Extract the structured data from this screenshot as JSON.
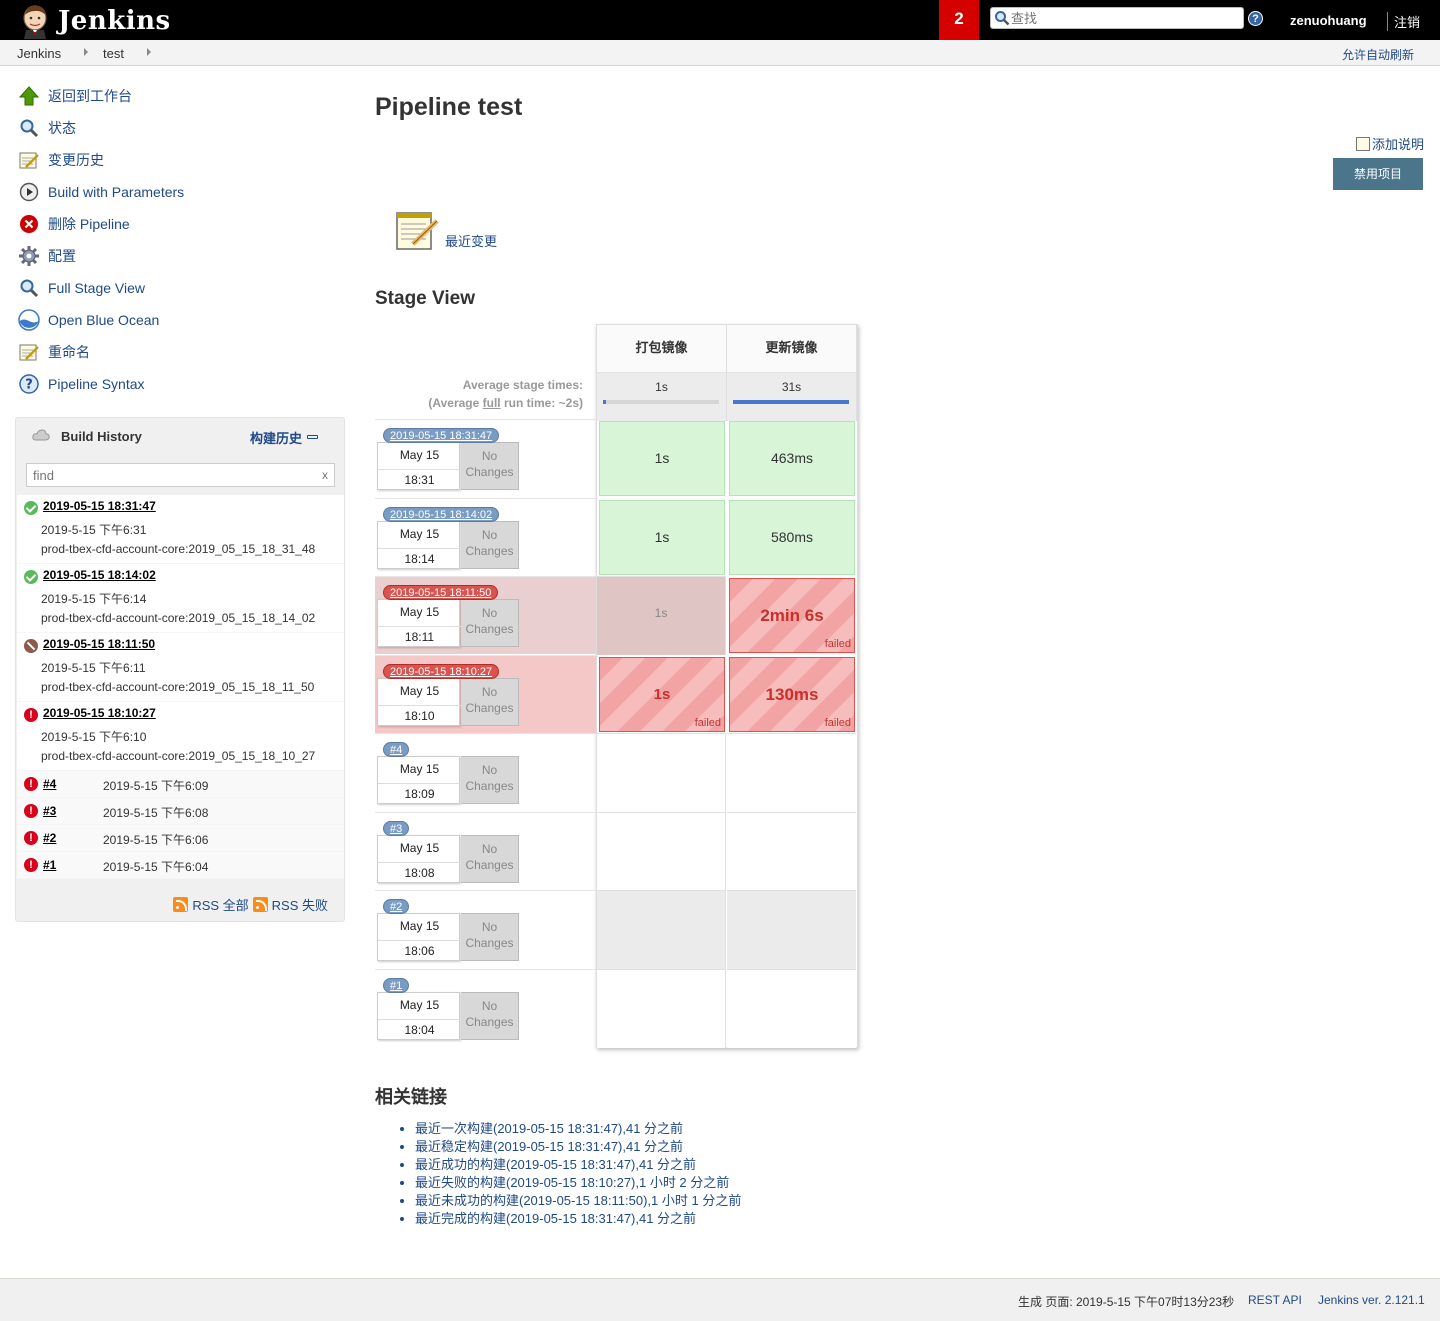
{
  "header": {
    "title": "Jenkins",
    "notification_count": "2",
    "search_placeholder": "查找",
    "user": "zenuohuang",
    "logout": "注销"
  },
  "breadcrumb": {
    "items": [
      "Jenkins",
      "test"
    ],
    "auto_refresh": "允许自动刷新"
  },
  "tasks": [
    {
      "label": "返回到工作台",
      "icon": "up-arrow-icon"
    },
    {
      "label": "状态",
      "icon": "search-icon"
    },
    {
      "label": "变更历史",
      "icon": "notepad-icon"
    },
    {
      "label": "Build with Parameters",
      "icon": "play-icon"
    },
    {
      "label": "删除 Pipeline",
      "icon": "delete-icon"
    },
    {
      "label": "配置",
      "icon": "gear-icon"
    },
    {
      "label": "Full Stage View",
      "icon": "search-icon"
    },
    {
      "label": "Open Blue Ocean",
      "icon": "blue-ocean-icon"
    },
    {
      "label": "重命名",
      "icon": "notepad-icon"
    },
    {
      "label": "Pipeline Syntax",
      "icon": "help-icon"
    }
  ],
  "build_history": {
    "title": "Build History",
    "trend": "构建历史",
    "filter_placeholder": "find",
    "filter_clear": "x",
    "builds": [
      {
        "name": "2019-05-15 18:31:47",
        "date": "2019-5-15 下午6:31",
        "desc": "prod-tbex-cfd-account-core:2019_05_15_18_31_48",
        "status": "success"
      },
      {
        "name": "2019-05-15 18:14:02",
        "date": "2019-5-15 下午6:14",
        "desc": "prod-tbex-cfd-account-core:2019_05_15_18_14_02",
        "status": "success"
      },
      {
        "name": "2019-05-15 18:11:50",
        "date": "2019-5-15 下午6:11",
        "desc": "prod-tbex-cfd-account-core:2019_05_15_18_11_50",
        "status": "aborted"
      },
      {
        "name": "2019-05-15 18:10:27",
        "date": "2019-5-15 下午6:10",
        "desc": "prod-tbex-cfd-account-core:2019_05_15_18_10_27",
        "status": "failed"
      },
      {
        "name": "#4",
        "date": "2019-5-15 下午6:09",
        "status": "failed"
      },
      {
        "name": "#3",
        "date": "2019-5-15 下午6:08",
        "status": "failed"
      },
      {
        "name": "#2",
        "date": "2019-5-15 下午6:06",
        "status": "failed"
      },
      {
        "name": "#1",
        "date": "2019-5-15 下午6:04",
        "status": "failed"
      }
    ],
    "rss_all": "RSS 全部",
    "rss_fail": "RSS 失败"
  },
  "main": {
    "title": "Pipeline test",
    "add_description": "添加说明",
    "disable_button": "禁用项目",
    "recent_changes": "最近变更",
    "stage_view_title": "Stage View",
    "avg_label_1": "Average stage times:",
    "avg_label_2a": "(Average ",
    "avg_label_2b": "full",
    "avg_label_2c": " run time: ~2s)"
  },
  "stage_view": {
    "stages": [
      {
        "name": "打包镜像",
        "avg": "1s",
        "avg_fill": 0.03
      },
      {
        "name": "更新镜像",
        "avg": "31s",
        "avg_fill": 1.0
      }
    ],
    "runs": [
      {
        "badge": "2019-05-15 18:31:47",
        "date": "May 15",
        "time": "18:31",
        "changes": [
          "No",
          "Changes"
        ],
        "state": "success",
        "cells": [
          {
            "text": "1s",
            "state": "ok"
          },
          {
            "text": "463ms",
            "state": "ok"
          }
        ]
      },
      {
        "badge": "2019-05-15 18:14:02",
        "date": "May 15",
        "time": "18:14",
        "changes": [
          "No",
          "Changes"
        ],
        "state": "success",
        "cells": [
          {
            "text": "1s",
            "state": "ok"
          },
          {
            "text": "580ms",
            "state": "ok"
          }
        ]
      },
      {
        "badge": "2019-05-15 18:11:50",
        "date": "May 15",
        "time": "18:11",
        "changes": [
          "No",
          "Changes"
        ],
        "state": "aborted",
        "cells": [
          {
            "text": "1s",
            "state": "dim"
          },
          {
            "text": "2min 6s",
            "state": "fail",
            "label": "failed"
          }
        ]
      },
      {
        "badge": "2019-05-15 18:10:27",
        "date": "May 15",
        "time": "18:10",
        "changes": [
          "No",
          "Changes"
        ],
        "state": "failed",
        "cells": [
          {
            "text": "1s",
            "state": "fail",
            "label": "failed"
          },
          {
            "text": "130ms",
            "state": "fail",
            "label": "failed"
          }
        ]
      },
      {
        "badge": "#4",
        "date": "May 15",
        "time": "18:09",
        "changes": [
          "No",
          "Changes"
        ],
        "state": "none",
        "cells": [
          {
            "text": "",
            "state": "empty"
          },
          {
            "text": "",
            "state": "empty"
          }
        ]
      },
      {
        "badge": "#3",
        "date": "May 15",
        "time": "18:08",
        "changes": [
          "No",
          "Changes"
        ],
        "state": "none",
        "cells": [
          {
            "text": "",
            "state": "empty"
          },
          {
            "text": "",
            "state": "empty"
          }
        ]
      },
      {
        "badge": "#2",
        "date": "May 15",
        "time": "18:06",
        "changes": [
          "No",
          "Changes"
        ],
        "state": "none",
        "cells": [
          {
            "text": "",
            "state": "grey"
          },
          {
            "text": "",
            "state": "grey"
          }
        ]
      },
      {
        "badge": "#1",
        "date": "May 15",
        "time": "18:04",
        "changes": [
          "No",
          "Changes"
        ],
        "state": "none",
        "cells": [
          {
            "text": "",
            "state": "empty"
          },
          {
            "text": "",
            "state": "empty"
          }
        ]
      }
    ]
  },
  "related": {
    "title": "相关链接",
    "links": [
      "最近一次构建(2019-05-15 18:31:47),41 分之前",
      "最近稳定构建(2019-05-15 18:31:47),41 分之前",
      "最近成功的构建(2019-05-15 18:31:47),41 分之前",
      "最近失败的构建(2019-05-15 18:10:27),1 小时 2 分之前",
      "最近未成功的构建(2019-05-15 18:11:50),1 小时 1 分之前",
      "最近完成的构建(2019-05-15 18:31:47),41 分之前"
    ]
  },
  "footer": {
    "generated": "生成 页面: 2019-5-15 下午07时13分23秒",
    "rest_api": "REST API",
    "version": "Jenkins ver. 2.121.1"
  }
}
